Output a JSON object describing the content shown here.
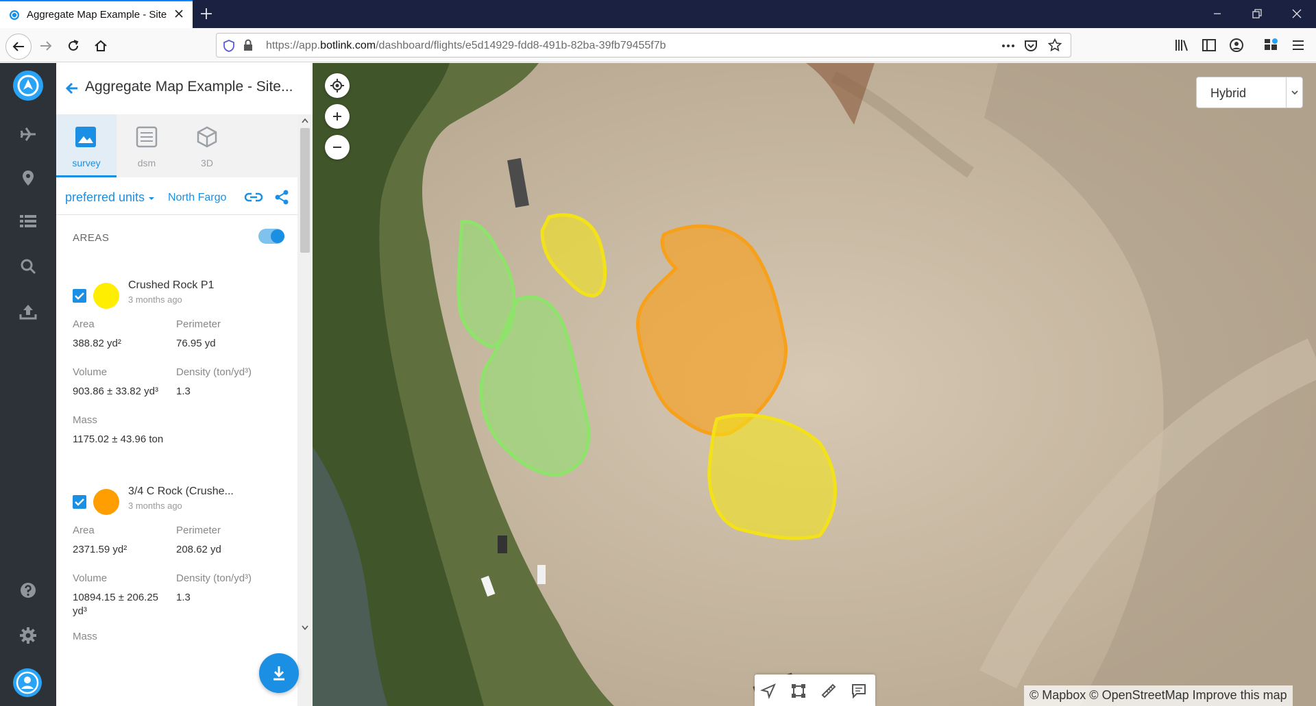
{
  "browser": {
    "tab_title": "Aggregate Map Example - Site",
    "url_prefix": "https://app.",
    "url_domain": "botlink.com",
    "url_path": "/dashboard/flights/e5d14929-fdd8-491b-82ba-39fb79455f7b"
  },
  "panel": {
    "title": "Aggregate Map Example - Site...",
    "tabs": [
      {
        "label": "survey",
        "active": true
      },
      {
        "label": "dsm",
        "active": false
      },
      {
        "label": "3D",
        "active": false
      }
    ],
    "units_label": "preferred units",
    "units_value": "North Fargo",
    "areas_title": "AREAS",
    "areas": [
      {
        "name": "Crushed Rock P1",
        "time": "3 months ago",
        "color": "#ffee00",
        "area_label": "Area",
        "area_value": "388.82 yd²",
        "perimeter_label": "Perimeter",
        "perimeter_value": "76.95 yd",
        "volume_label": "Volume",
        "volume_value": "903.86 ± 33.82 yd³",
        "density_label": "Density (ton/yd³)",
        "density_value": "1.3",
        "mass_label": "Mass",
        "mass_value": "1175.02 ± 43.96 ton"
      },
      {
        "name": "3/4 C Rock (Crushe...",
        "time": "3 months ago",
        "color": "#ff9e00",
        "area_label": "Area",
        "area_value": "2371.59 yd²",
        "perimeter_label": "Perimeter",
        "perimeter_value": "208.62 yd",
        "volume_label": "Volume",
        "volume_value_1": "10894.15 ± 206.25",
        "volume_value_2": "yd³",
        "density_label": "Density (ton/yd³)",
        "density_value": "1.3",
        "mass_label": "Mass"
      }
    ]
  },
  "map": {
    "map_type": "Hybrid",
    "attribution": "© Mapbox © OpenStreetMap Improve this map",
    "polygon_colors": {
      "green": "#8ee36b",
      "yellow": "#f3e21a",
      "orange": "#f7a01c"
    }
  },
  "colors": {
    "accent": "#1a8fe3",
    "rail_bg": "#2d3239",
    "tabbar_bg": "#1b2140"
  }
}
